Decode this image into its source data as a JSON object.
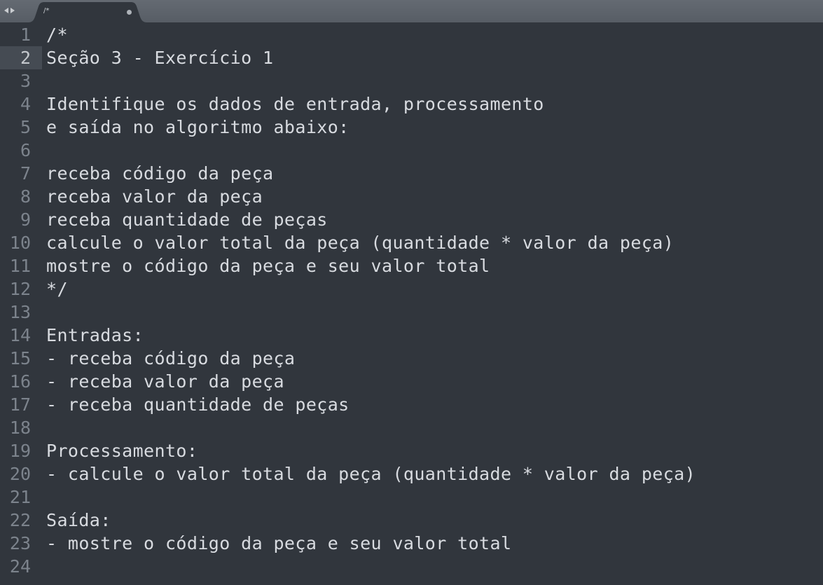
{
  "tab": {
    "title": "/*",
    "modified": true
  },
  "editor": {
    "current_line": 2,
    "lines": [
      {
        "number": "1",
        "text": "/*"
      },
      {
        "number": "2",
        "text": "Seção 3 - Exercício 1"
      },
      {
        "number": "3",
        "text": ""
      },
      {
        "number": "4",
        "text": "Identifique os dados de entrada, processamento"
      },
      {
        "number": "5",
        "text": "e saída no algoritmo abaixo:"
      },
      {
        "number": "6",
        "text": ""
      },
      {
        "number": "7",
        "text": "receba código da peça"
      },
      {
        "number": "8",
        "text": "receba valor da peça"
      },
      {
        "number": "9",
        "text": "receba quantidade de peças"
      },
      {
        "number": "10",
        "text": "calcule o valor total da peça (quantidade * valor da peça)"
      },
      {
        "number": "11",
        "text": "mostre o código da peça e seu valor total"
      },
      {
        "number": "12",
        "text": "*/"
      },
      {
        "number": "13",
        "text": ""
      },
      {
        "number": "14",
        "text": "Entradas:"
      },
      {
        "number": "15",
        "text": "- receba código da peça"
      },
      {
        "number": "16",
        "text": "- receba valor da peça"
      },
      {
        "number": "17",
        "text": "- receba quantidade de peças"
      },
      {
        "number": "18",
        "text": ""
      },
      {
        "number": "19",
        "text": "Processamento:"
      },
      {
        "number": "20",
        "text": "- calcule o valor total da peça (quantidade * valor da peça)"
      },
      {
        "number": "21",
        "text": ""
      },
      {
        "number": "22",
        "text": "Saída:"
      },
      {
        "number": "23",
        "text": "- mostre o código da peça e seu valor total"
      },
      {
        "number": "24",
        "text": ""
      }
    ]
  },
  "colors": {
    "background": "#31363d",
    "tabbar": "#5a6068",
    "active_tab": "#31363d",
    "text": "#d8dbe0",
    "gutter_text": "#7c838c",
    "current_line_highlight": "#454b53"
  }
}
